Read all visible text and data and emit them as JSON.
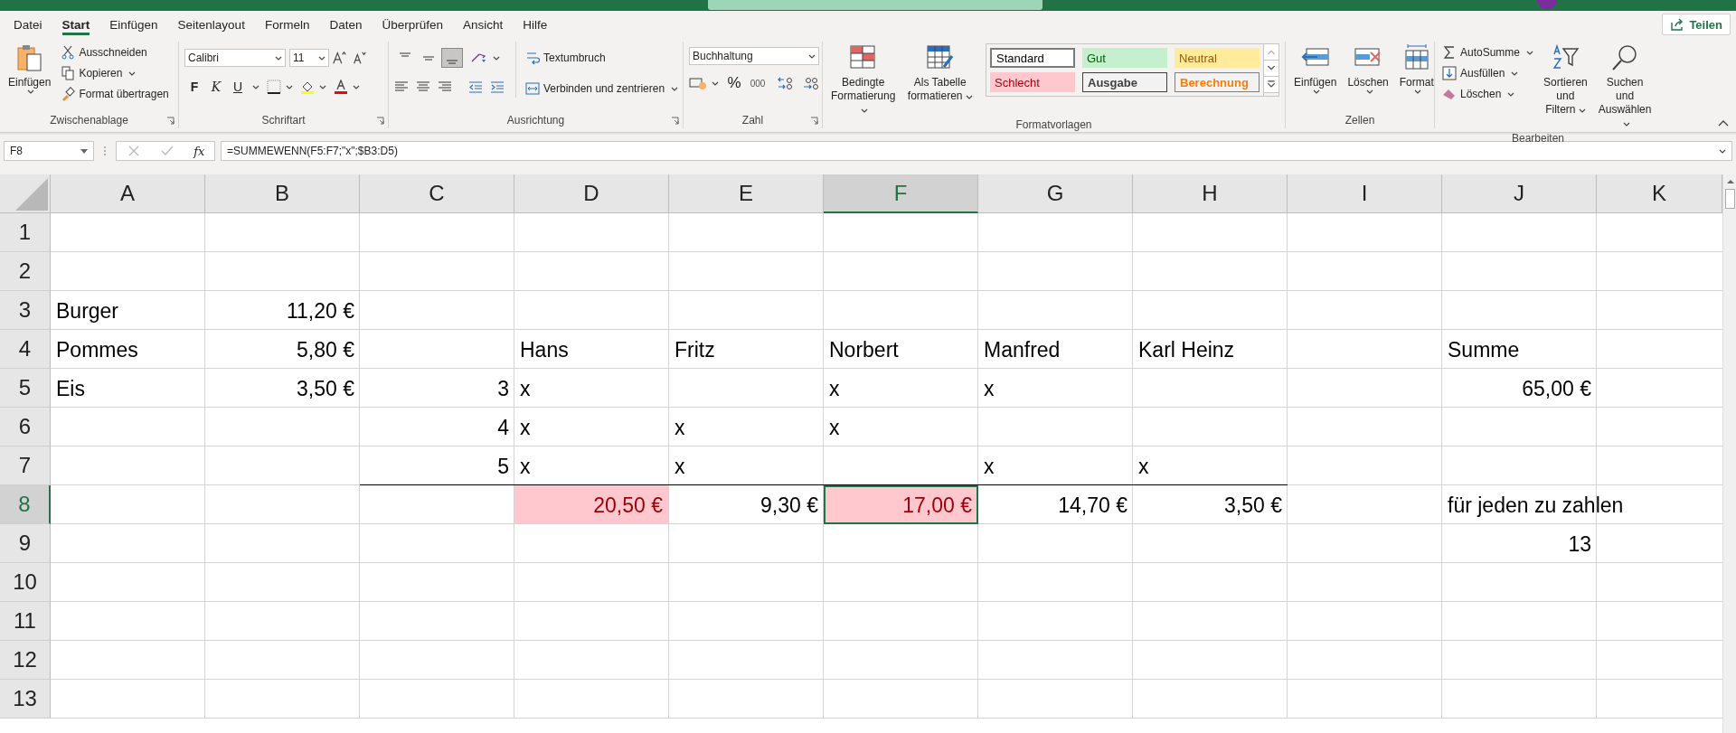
{
  "tabs": [
    {
      "label": "Datei",
      "selected": false
    },
    {
      "label": "Start",
      "selected": true
    },
    {
      "label": "Einfügen",
      "selected": false
    },
    {
      "label": "Seitenlayout",
      "selected": false
    },
    {
      "label": "Formeln",
      "selected": false
    },
    {
      "label": "Daten",
      "selected": false
    },
    {
      "label": "Überprüfen",
      "selected": false
    },
    {
      "label": "Ansicht",
      "selected": false
    },
    {
      "label": "Hilfe",
      "selected": false
    }
  ],
  "share_button": "Teilen",
  "ribbon": {
    "clipboard": {
      "label": "Zwischenablage",
      "paste": "Einfügen",
      "cut": "Ausschneiden",
      "copy": "Kopieren",
      "painter": "Format übertragen"
    },
    "font": {
      "label": "Schriftart",
      "font_name": "Calibri",
      "font_size": "11",
      "bold": "F",
      "italic": "K",
      "underline": "U"
    },
    "alignment": {
      "label": "Ausrichtung",
      "vertical_buttons": [
        {
          "selected": false
        },
        {
          "selected": false
        },
        {
          "selected": true
        }
      ],
      "wrap": "Textumbruch",
      "merge": "Verbinden und zentrieren"
    },
    "number": {
      "label": "Zahl",
      "format": "Buchhaltung",
      "percent": "%",
      "thousands": "000"
    },
    "styles": {
      "label": "Formatvorlagen",
      "conditional": "Bedingte Formatierung",
      "as_table": "Als Tabelle formatieren",
      "cell_styles": [
        {
          "label": "Standard",
          "kind": "standard"
        },
        {
          "label": "Gut",
          "kind": "good"
        },
        {
          "label": "Neutral",
          "kind": "neutral"
        },
        {
          "label": "Schlecht",
          "kind": "bad"
        },
        {
          "label": "Ausgabe",
          "kind": "output"
        },
        {
          "label": "Berechnung",
          "kind": "calculation"
        }
      ]
    },
    "cells": {
      "label": "Zellen",
      "buttons": [
        {
          "label": "Einfügen",
          "kind": "insert"
        },
        {
          "label": "Löschen",
          "kind": "delete"
        },
        {
          "label": "Format",
          "kind": "format"
        }
      ]
    },
    "editing": {
      "label": "Bearbeiten",
      "autosum": "AutoSumme",
      "fill": "Ausfüllen",
      "clear": "Löschen",
      "sort": "Sortieren und Filtern",
      "find": "Suchen und Auswählen"
    }
  },
  "formula_bar": {
    "name_box": "F8",
    "function_label": "fx",
    "formula": "=SUMMEWENN(F5:F7;\"x\";$B3:D5)"
  },
  "columns": [
    {
      "letter": "A",
      "selected": false
    },
    {
      "letter": "B",
      "selected": false
    },
    {
      "letter": "C",
      "selected": false
    },
    {
      "letter": "D",
      "selected": false
    },
    {
      "letter": "E",
      "selected": false
    },
    {
      "letter": "F",
      "selected": true
    },
    {
      "letter": "G",
      "selected": false
    },
    {
      "letter": "H",
      "selected": false
    },
    {
      "letter": "I",
      "selected": false
    },
    {
      "letter": "J",
      "selected": false
    },
    {
      "letter": "K",
      "selected": false
    }
  ],
  "rows": [
    {
      "number": "1",
      "selected": false,
      "cells": [
        {
          "selected": false
        },
        {
          "selected": false
        },
        {
          "selected": false
        },
        {
          "selected": false
        },
        {
          "selected": false
        },
        {
          "selected": false
        },
        {
          "selected": false
        },
        {
          "selected": false
        },
        {
          "selected": false
        },
        {
          "selected": false
        },
        {
          "selected": false
        }
      ]
    },
    {
      "number": "2",
      "selected": false,
      "cells": [
        {
          "selected": false
        },
        {
          "selected": false
        },
        {
          "selected": false
        },
        {
          "selected": false
        },
        {
          "selected": false
        },
        {
          "selected": false
        },
        {
          "selected": false
        },
        {
          "selected": false
        },
        {
          "selected": false
        },
        {
          "selected": false
        },
        {
          "selected": false
        }
      ]
    },
    {
      "number": "3",
      "selected": false,
      "cells": [
        {
          "text": "Burger",
          "kind": "text",
          "selected": false
        },
        {
          "text": "11,20 €",
          "kind": "number",
          "selected": false
        },
        {
          "selected": false
        },
        {
          "selected": false
        },
        {
          "selected": false
        },
        {
          "selected": false
        },
        {
          "selected": false
        },
        {
          "selected": false
        },
        {
          "selected": false
        },
        {
          "selected": false
        },
        {
          "selected": false
        }
      ]
    },
    {
      "number": "4",
      "selected": false,
      "cells": [
        {
          "text": "Pommes",
          "kind": "text",
          "selected": false
        },
        {
          "text": "5,80 €",
          "kind": "number",
          "selected": false
        },
        {
          "selected": false
        },
        {
          "text": "Hans",
          "kind": "text",
          "selected": false
        },
        {
          "text": "Fritz",
          "kind": "text",
          "selected": false
        },
        {
          "text": "Norbert",
          "kind": "text",
          "selected": false
        },
        {
          "text": "Manfred",
          "kind": "text",
          "selected": false
        },
        {
          "text": "Karl Heinz",
          "kind": "text",
          "selected": false
        },
        {
          "selected": false
        },
        {
          "text": "Summe",
          "kind": "text",
          "selected": false
        },
        {
          "selected": false
        }
      ]
    },
    {
      "number": "5",
      "selected": false,
      "cells": [
        {
          "text": "Eis",
          "kind": "text",
          "selected": false
        },
        {
          "text": "3,50 €",
          "kind": "number",
          "selected": false
        },
        {
          "text": "3",
          "kind": "number",
          "selected": false
        },
        {
          "text": "x",
          "kind": "text",
          "selected": false
        },
        {
          "selected": false
        },
        {
          "text": "x",
          "kind": "text",
          "selected": false
        },
        {
          "text": "x",
          "kind": "text",
          "selected": false
        },
        {
          "selected": false
        },
        {
          "selected": false
        },
        {
          "text": "65,00 €",
          "kind": "number",
          "selected": false
        },
        {
          "selected": false
        }
      ]
    },
    {
      "number": "6",
      "selected": false,
      "cells": [
        {
          "selected": false
        },
        {
          "selected": false
        },
        {
          "text": "4",
          "kind": "number",
          "selected": false
        },
        {
          "text": "x",
          "kind": "text",
          "selected": false
        },
        {
          "text": "x",
          "kind": "text",
          "selected": false
        },
        {
          "text": "x",
          "kind": "text",
          "selected": false
        },
        {
          "selected": false
        },
        {
          "selected": false
        },
        {
          "selected": false
        },
        {
          "selected": false
        },
        {
          "selected": false
        }
      ]
    },
    {
      "number": "7",
      "selected": false,
      "cells": [
        {
          "selected": false
        },
        {
          "selected": false
        },
        {
          "text": "5",
          "kind": "number",
          "selected": false,
          "border_bottom": true
        },
        {
          "text": "x",
          "kind": "text",
          "selected": false,
          "border_bottom": true
        },
        {
          "text": "x",
          "kind": "text",
          "selected": false,
          "border_bottom": true
        },
        {
          "selected": false,
          "border_bottom": true
        },
        {
          "text": "x",
          "kind": "text",
          "selected": false,
          "border_bottom": true
        },
        {
          "text": "x",
          "kind": "text",
          "selected": false,
          "border_bottom": true
        },
        {
          "selected": false
        },
        {
          "selected": false
        },
        {
          "selected": false
        }
      ]
    },
    {
      "number": "8",
      "selected": true,
      "cells": [
        {
          "selected": false
        },
        {
          "selected": false
        },
        {
          "selected": false
        },
        {
          "text": "20,50 €",
          "kind": "flagged",
          "selected": false
        },
        {
          "text": "9,30 €",
          "kind": "number",
          "selected": false
        },
        {
          "text": "17,00 €",
          "kind": "flagged",
          "selected": true
        },
        {
          "text": "14,70 €",
          "kind": "number",
          "selected": false
        },
        {
          "text": "3,50 €",
          "kind": "number",
          "selected": false
        },
        {
          "selected": false
        },
        {
          "text": "für jeden zu zahlen",
          "kind": "text",
          "selected": false
        },
        {
          "selected": false
        }
      ]
    },
    {
      "number": "9",
      "selected": false,
      "cells": [
        {
          "selected": false
        },
        {
          "selected": false
        },
        {
          "selected": false
        },
        {
          "selected": false
        },
        {
          "selected": false
        },
        {
          "selected": false
        },
        {
          "selected": false
        },
        {
          "selected": false
        },
        {
          "selected": false
        },
        {
          "text": "13",
          "kind": "number",
          "selected": false
        },
        {
          "selected": false
        }
      ]
    },
    {
      "number": "10",
      "selected": false,
      "cells": [
        {
          "selected": false
        },
        {
          "selected": false
        },
        {
          "selected": false
        },
        {
          "selected": false
        },
        {
          "selected": false
        },
        {
          "selected": false
        },
        {
          "selected": false
        },
        {
          "selected": false
        },
        {
          "selected": false
        },
        {
          "selected": false
        },
        {
          "selected": false
        }
      ]
    },
    {
      "number": "11",
      "selected": false,
      "cells": [
        {
          "selected": false
        },
        {
          "selected": false
        },
        {
          "selected": false
        },
        {
          "selected": false
        },
        {
          "selected": false
        },
        {
          "selected": false
        },
        {
          "selected": false
        },
        {
          "selected": false
        },
        {
          "selected": false
        },
        {
          "selected": false
        },
        {
          "selected": false
        }
      ]
    },
    {
      "number": "12",
      "selected": false,
      "cells": [
        {
          "selected": false
        },
        {
          "selected": false
        },
        {
          "selected": false
        },
        {
          "selected": false
        },
        {
          "selected": false
        },
        {
          "selected": false
        },
        {
          "selected": false
        },
        {
          "selected": false
        },
        {
          "selected": false
        },
        {
          "selected": false
        },
        {
          "selected": false
        }
      ]
    },
    {
      "number": "13",
      "selected": false,
      "cells": [
        {
          "selected": false
        },
        {
          "selected": false
        },
        {
          "selected": false
        },
        {
          "selected": false
        },
        {
          "selected": false
        },
        {
          "selected": false
        },
        {
          "selected": false
        },
        {
          "selected": false
        },
        {
          "selected": false
        },
        {
          "selected": false
        },
        {
          "selected": false
        }
      ]
    }
  ]
}
